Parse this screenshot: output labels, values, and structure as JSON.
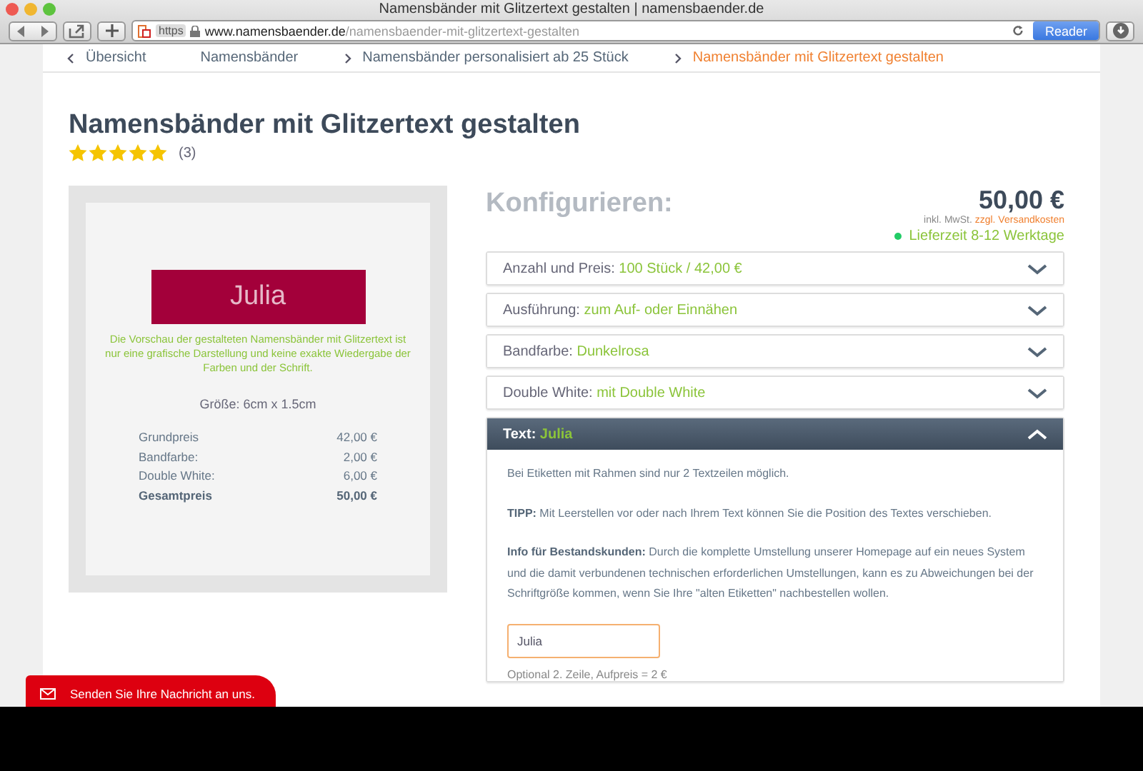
{
  "window": {
    "title": "Namensbänder mit Glitzertext gestalten | namensbaender.de"
  },
  "address_bar": {
    "scheme": "https",
    "domain": "www.namensbaender.de",
    "path": "/namensbaender-mit-glitzertext-gestalten",
    "reader": "Reader"
  },
  "breadcrumb": [
    {
      "label": "Übersicht",
      "kind": "back"
    },
    {
      "label": "Namensbänder",
      "kind": "link"
    },
    {
      "label": "Namensbänder personalisiert ab 25 Stück",
      "kind": "link"
    },
    {
      "label": "Namensbänder mit Glitzertext gestalten",
      "kind": "current"
    }
  ],
  "product": {
    "title": "Namensbänder mit Glitzertext gestalten",
    "stars": 5,
    "review_count": "(3)"
  },
  "preview": {
    "label_text": "Julia",
    "note": "Die Vorschau der gestalteten Namensbänder mit Glitzertext ist nur eine grafische Darstellung und keine exakte Wiedergabe der Farben und der Schrift.",
    "size": "Größe: 6cm x 1.5cm",
    "prices": [
      {
        "label": "Grundpreis",
        "value": "42,00 €",
        "total": false
      },
      {
        "label": "Bandfarbe:",
        "value": "2,00 €",
        "total": false
      },
      {
        "label": "Double White:",
        "value": "6,00 €",
        "total": false
      },
      {
        "label": "Gesamtpreis",
        "value": "50,00 €",
        "total": true
      }
    ]
  },
  "configurator": {
    "heading": "Konfigurieren:",
    "price": "50,00 €",
    "tax_note": "inkl. MwSt.",
    "shipping_link": "zzgl. Versandkosten",
    "delivery": "Lieferzeit 8-12 Werktage",
    "options": [
      {
        "label": "Anzahl und Preis:",
        "value": "100 Stück / 42,00 €",
        "expanded": false
      },
      {
        "label": "Ausführung:",
        "value": "zum Auf- oder Einnähen",
        "expanded": false
      },
      {
        "label": "Bandfarbe:",
        "value": "Dunkelrosa",
        "expanded": false
      },
      {
        "label": "Double White:",
        "value": "mit Double White",
        "expanded": false
      },
      {
        "label": "Text:",
        "value": "Julia",
        "expanded": true,
        "body": [
          "Bei Etiketten mit Rahmen sind nur 2 Textzeilen möglich.",
          "**TIPP:** Mit Leerstellen vor oder nach Ihrem Text können Sie die Position des Textes verschieben.",
          "**Info für Bestandskunden:** Durch die komplette Umstellung unserer Homepage auf ein neues System und die damit verbundenen technischen erforderlichen Umstellungen, kann es zu Abweichungen bei der Schriftgröße kommen, wenn Sie Ihre \"alten Etiketten\" nachbestellen wollen."
        ],
        "input_value": "Julia",
        "optional_note": "Optional 2. Zeile, Aufpreis = 2 €"
      }
    ]
  },
  "contact_button": {
    "label": "Senden Sie Ihre Nachricht an uns."
  }
}
